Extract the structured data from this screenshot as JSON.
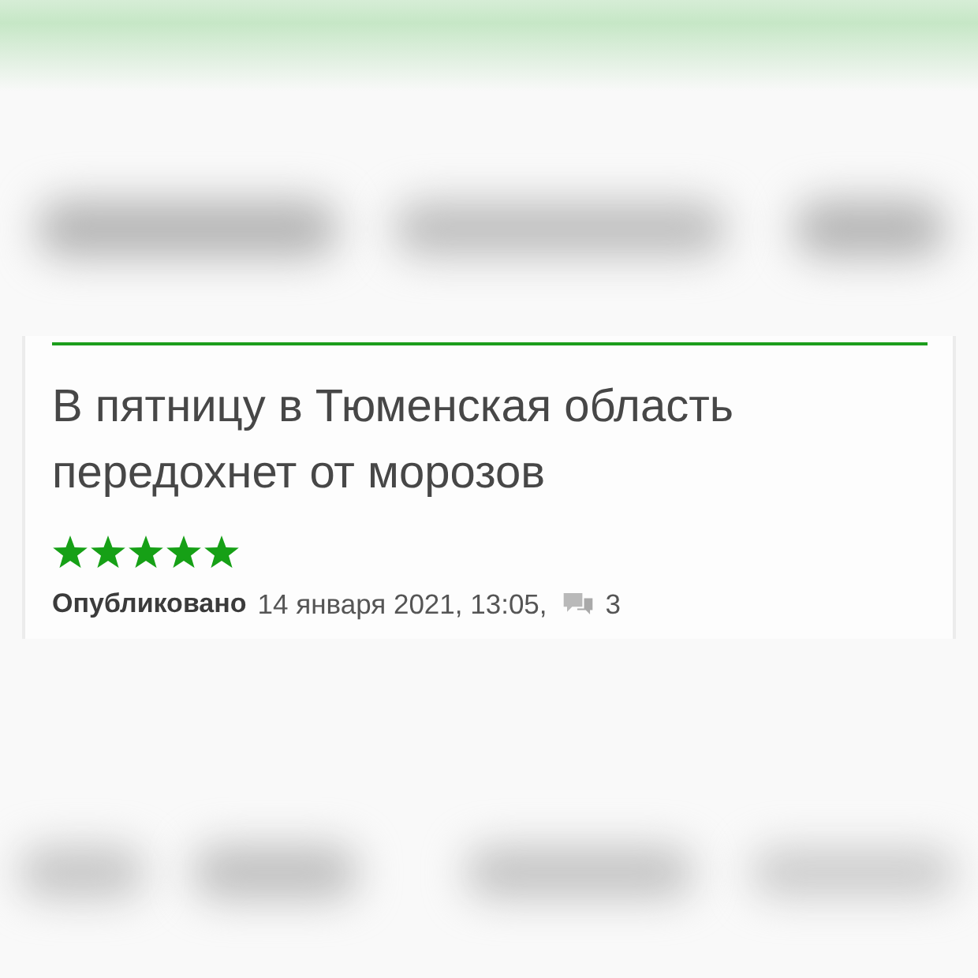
{
  "article": {
    "title": "В пятницу в Тюменская область передохнет от морозов",
    "stars": 5,
    "meta": {
      "label": "Опубликовано",
      "date": "14 января 2021, 13:05,",
      "comments": "3"
    }
  }
}
